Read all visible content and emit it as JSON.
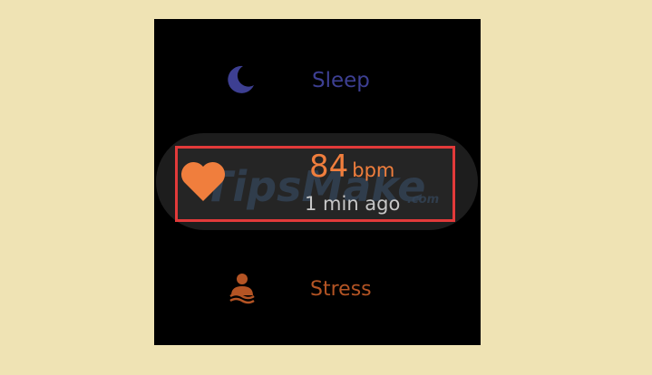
{
  "tiles": {
    "sleep": {
      "label": "Sleep",
      "icon": "moon-icon",
      "color": "#3d3f92"
    },
    "heart_rate": {
      "value": "84",
      "unit": "bpm",
      "time": "1 min ago",
      "icon": "heart-icon",
      "color": "#f07e3d"
    },
    "stress": {
      "label": "Stress",
      "icon": "stress-person-icon",
      "color": "#b45424"
    }
  },
  "watermark": {
    "text": "TipsMake",
    "suffix": ".com"
  },
  "colors": {
    "background": "#efe3b4",
    "screen": "#000000",
    "highlight_border": "#e23a3a"
  }
}
